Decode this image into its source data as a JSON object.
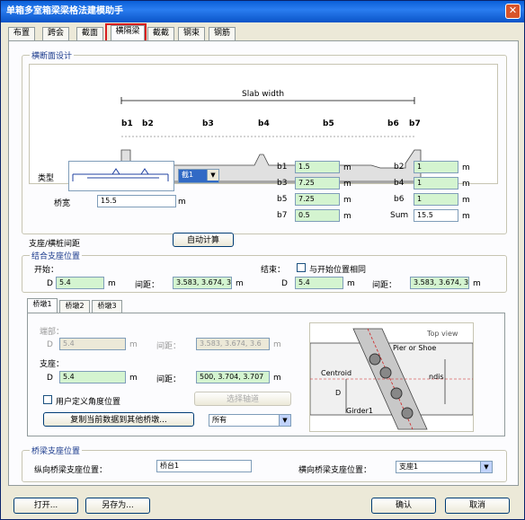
{
  "window": {
    "title": "单箱多室箱梁梁格法建模助手",
    "close": "✕"
  },
  "tabs": [
    "布置",
    "跨会",
    "截面",
    "横隔梁",
    "截截",
    "钢束",
    "钢筋"
  ],
  "section": {
    "title": "横断面设计",
    "diagram": {
      "slab_width": "Slab width",
      "labels": [
        "b1",
        "b2",
        "b3",
        "b4",
        "b5",
        "b6",
        "b7"
      ]
    },
    "type_label": "类型",
    "type_select": "截1",
    "width_label": "桥宽",
    "width_value": "15.5",
    "width_unit": "m",
    "params": [
      {
        "label": "b1",
        "value": "1.5",
        "unit": "m"
      },
      {
        "label": "b2",
        "value": "1",
        "unit": "m"
      },
      {
        "label": "b3",
        "value": "7.25",
        "unit": "m"
      },
      {
        "label": "b4",
        "value": "1",
        "unit": "m"
      },
      {
        "label": "b5",
        "value": "7.25",
        "unit": "m"
      },
      {
        "label": "b6",
        "value": "1",
        "unit": "m"
      },
      {
        "label": "b7",
        "value": "0.5",
        "unit": "m"
      },
      {
        "label": "Sum",
        "value": "15.5",
        "unit": "m"
      }
    ]
  },
  "support": {
    "label": "支座/横桩间距",
    "auto_btn": "自动计算",
    "group_title": "结合支座位置",
    "start_label": "开始：",
    "end_label": "结束：",
    "same_as_start": "与开始位置相同",
    "d_label": "D",
    "d_start": "5.4",
    "d_end": "5.4",
    "unit": "m",
    "spacing_label": "间距：",
    "spacing_start": "3.583, 3.674, 3",
    "spacing_end": "3.583, 3.674, 3"
  },
  "pier": {
    "subtabs": [
      "桥墩1",
      "桥墩2",
      "桥墩3"
    ],
    "start_label": "端部：",
    "d_label": "D",
    "d_start": "5.4",
    "spacing_label": "间距：",
    "spacing_start": "3.583, 3.674, 3.6",
    "end_label": "支座：",
    "d_end": "5.4",
    "spacing_end": "500, 3.704, 3.707",
    "unit": "m",
    "user_defined": "用户定义角度位置",
    "choose_btn": "选择轴道",
    "apply_btn": "复制当前数据到其他桥墩...",
    "apply_select": "所有",
    "diagram": {
      "top_view": "Top view",
      "pier_shoe": "Pier or Shoe",
      "centroid": "Centroid",
      "d": "D",
      "girder": "Girder1",
      "ndis": "ndis"
    }
  },
  "struct": {
    "group_title": "桥梁支座位置",
    "long_label": "纵向桥梁支座位置：",
    "long_value": "桥台1",
    "trans_label": "横向桥梁支座位置：",
    "trans_value": "支座1"
  },
  "footer": {
    "open": "打开...",
    "save_as": "另存为...",
    "ok": "确认",
    "cancel": "取消"
  }
}
